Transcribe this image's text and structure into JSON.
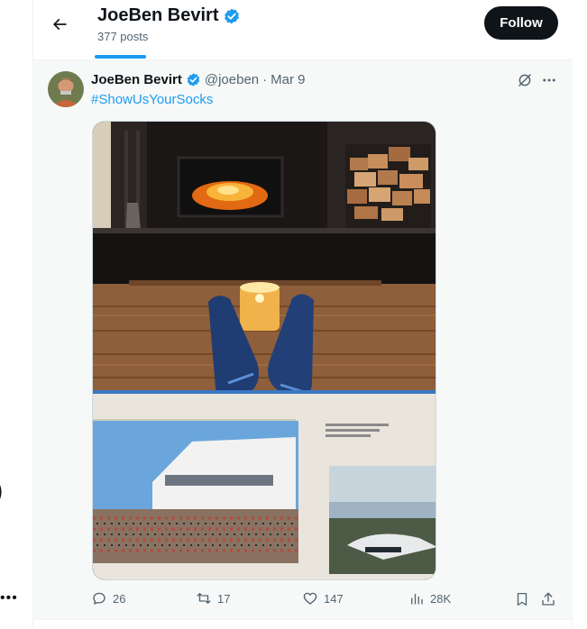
{
  "header": {
    "back_icon": "arrow-left-icon",
    "name": "JoeBen Bevirt",
    "verified_icon": "verified-badge-icon",
    "post_count": "377 posts",
    "follow_label": "Follow"
  },
  "tweet": {
    "author_name": "JoeBen Bevirt",
    "verified_icon": "verified-badge-icon",
    "handle": "@joeben",
    "separator": "·",
    "date": "Mar 9",
    "hashtag": "#ShowUsYourSocks",
    "grok_icon": "grok-icon",
    "more_icon": "more-dots-icon",
    "media_icon": "photo-socks-fireplace",
    "actions": {
      "reply_count": "26",
      "repost_count": "17",
      "like_count": "147",
      "views_count": "28K"
    }
  },
  "colors": {
    "accent": "#1d9bf0",
    "text_primary": "#0f1419",
    "text_secondary": "#536471",
    "follow_bg": "#0f1419"
  }
}
